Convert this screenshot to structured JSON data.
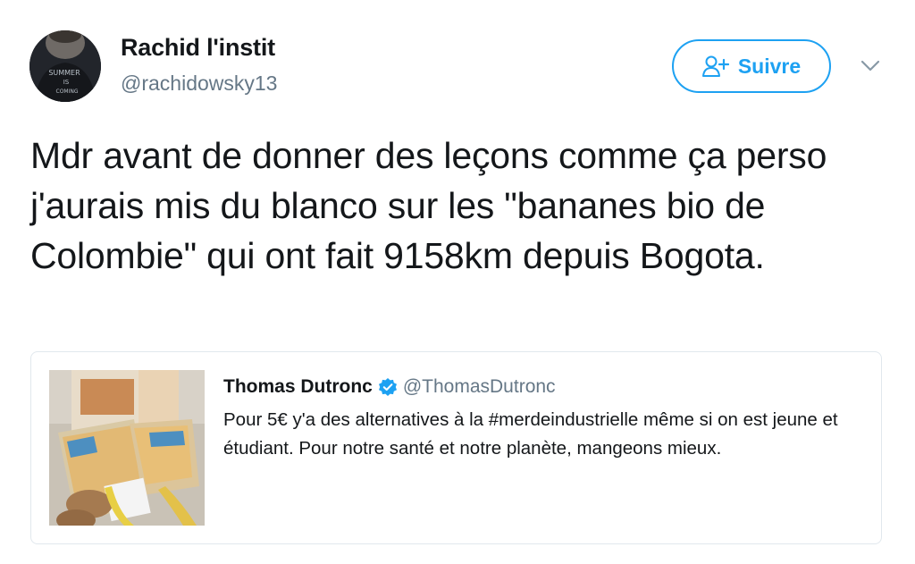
{
  "author": {
    "name": "Rachid l'instit",
    "handle": "@rachidowsky13"
  },
  "follow_button": {
    "label": "Suivre"
  },
  "icons": {
    "follow": "person-add-icon",
    "caret": "chevron-down-icon",
    "verified": "verified-badge-icon"
  },
  "colors": {
    "accent": "#1da1f2",
    "text": "#14171a",
    "secondary": "#657786",
    "border": "#e1e8ed"
  },
  "tweet": {
    "text": "Mdr avant de donner des leçons comme ça perso j'aurais mis du blanco sur les \"bananes bio de Colombie\" qui ont fait 9158km depuis Bogota."
  },
  "quoted_tweet": {
    "name": "Thomas Dutronc",
    "handle": "@ThomasDutronc",
    "text": "Pour 5€ y'a des alternatives à la #merdeindustrielle même si on est jeune et étudiant. Pour notre santé et notre planète, mangeons mieux."
  }
}
